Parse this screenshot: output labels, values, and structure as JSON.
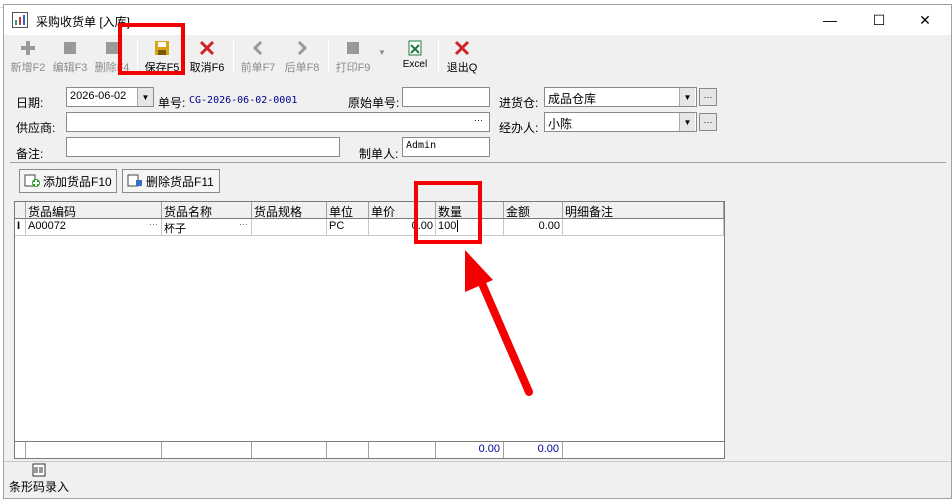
{
  "window": {
    "title": "采购收货单 [入库]",
    "controls": {
      "minimize": "—",
      "maximize": "☐",
      "close": "✕"
    }
  },
  "toolbar": {
    "items": [
      {
        "label": "新增F2",
        "icon": "plus-icon",
        "enabled": false
      },
      {
        "label": "编辑F3",
        "icon": "edit-icon",
        "enabled": false
      },
      {
        "label": "删除F4",
        "icon": "delete-icon",
        "enabled": false
      },
      {
        "label": "保存F5",
        "icon": "floppy-save-icon",
        "enabled": true
      },
      {
        "label": "取消F6",
        "icon": "cancel-x-icon",
        "enabled": true
      },
      {
        "label": "前单F7",
        "icon": "arrow-left-icon",
        "enabled": false
      },
      {
        "label": "后单F8",
        "icon": "arrow-right-icon",
        "enabled": false
      },
      {
        "label": "打印F9",
        "icon": "print-icon",
        "enabled": false
      },
      {
        "label": "Excel",
        "icon": "excel-icon",
        "enabled": true
      },
      {
        "label": "退出Q",
        "icon": "exit-x-icon",
        "enabled": true
      }
    ]
  },
  "form": {
    "date_label": "日期:",
    "date_value": "2026-06-02",
    "order_no_label": "单号:",
    "order_no_value": "CG-2026-06-02-0001",
    "original_no_label": "原始单号:",
    "original_no_value": "",
    "warehouse_label": "进货仓:",
    "warehouse_value": "成品仓库",
    "supplier_label": "供应商:",
    "supplier_value": "",
    "handler_label": "经办人:",
    "handler_value": "小陈",
    "remark_label": "备注:",
    "remark_value": "",
    "maker_label": "制单人:",
    "maker_value": "Admin",
    "ellipsis": "···",
    "dropdown_arrow": "▼"
  },
  "actions": {
    "add_goods": "添加货品F10",
    "delete_goods": "删除货品F11"
  },
  "grid": {
    "columns": [
      "货品编码",
      "货品名称",
      "货品规格",
      "单位",
      "单价",
      "数量",
      "金额",
      "明细备注"
    ],
    "rows": [
      {
        "indicator": "I",
        "code": "A00072",
        "name": "杯子",
        "spec": "",
        "unit": "PC",
        "price": "0.00",
        "qty": "100",
        "amount": "0.00",
        "note": ""
      }
    ],
    "footer": {
      "qty_total": "0.00",
      "amount_total": "0.00"
    }
  },
  "bottom": {
    "barcode_label": "条形码录入"
  },
  "annotation_colors": {
    "highlight": "#f40000"
  }
}
